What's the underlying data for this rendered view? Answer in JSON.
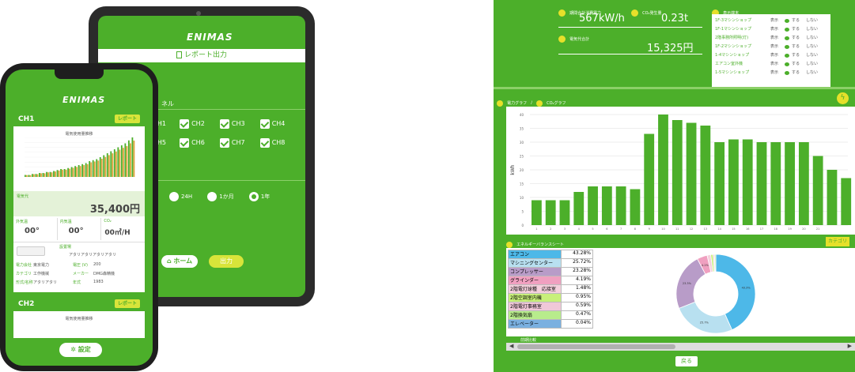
{
  "tablet": {
    "logo": "ENIMAS",
    "report_title": "レポート出力",
    "channel_section_suffix": "ネル",
    "channels": [
      "CH1",
      "CH2",
      "CH3",
      "CH4",
      "CH5",
      "CH6",
      "CH7",
      "CH8"
    ],
    "periods": [
      "24H",
      "1か月",
      "1年"
    ],
    "selected_period": "1年",
    "home_button": "ホーム",
    "output_button": "出力"
  },
  "phone": {
    "logo": "ENIMAS",
    "ch1": {
      "title": "CH1",
      "report_button": "レポート",
      "chart_title": "電気使用量推移",
      "chart_values": [
        2,
        2,
        3,
        3,
        4,
        4,
        5,
        5,
        6,
        7,
        8,
        8,
        9,
        10,
        11,
        12,
        13,
        14,
        16,
        17,
        18,
        20,
        22,
        24,
        26,
        28,
        30,
        32,
        34,
        37,
        40
      ],
      "electricity_cost_label": "電気代",
      "electricity_cost": "35,400円",
      "outdoor_temp_label": "外気温",
      "outdoor_temp": "00°",
      "indoor_temp_label": "内気温",
      "indoor_temp": "00°",
      "co2_label": "CO₂",
      "co2": "00㎥/H",
      "location_label": "設置場",
      "location": "アタリアタリアタリアタリ",
      "details": [
        {
          "label": "電力会社",
          "value": "東京電力",
          "label2": "電圧 (V)",
          "value2": "200"
        },
        {
          "label": "カテゴリ",
          "value": "工作機械",
          "label2": "メーカー",
          "value2": "DMG森精機"
        },
        {
          "label": "形式/名称",
          "value": "アタリアタリ",
          "label2": "年式",
          "value2": "1983"
        }
      ]
    },
    "ch2": {
      "title": "CH2",
      "report_button": "レポート",
      "chart_title": "電気使用量推移"
    },
    "settings_button": "設定"
  },
  "app": {
    "summary": {
      "period_power_label": "期間合計消費電力",
      "period_power": "567kW/h",
      "co2_label": "CO₂発生量",
      "co2": "0.23t",
      "cost_label": "電気代合計",
      "cost": "15,325円"
    },
    "display_terminal": {
      "title": "表示端末",
      "rows": [
        {
          "name": "1F-3マシンショップ",
          "show": "表示",
          "on": "する",
          "off": "しない"
        },
        {
          "name": "1F-1マシンショップ",
          "show": "表示",
          "on": "する",
          "off": "しない"
        },
        {
          "name": "2階事務所照明(灯)",
          "show": "表示",
          "on": "する",
          "off": "しない"
        },
        {
          "name": "1F-2マシンショップ",
          "show": "表示",
          "on": "する",
          "off": "しない"
        },
        {
          "name": "1-4マシンショップ",
          "show": "表示",
          "on": "する",
          "off": "しない"
        },
        {
          "name": "エアコン室外機",
          "show": "表示",
          "on": "する",
          "off": "しない"
        },
        {
          "name": "1-5マシンショップ",
          "show": "表示",
          "on": "する",
          "off": "しない"
        }
      ]
    },
    "graph_tabs": [
      "電力グラフ",
      "CO₂グラフ"
    ],
    "graph_tab_separator": "/",
    "energy_title": "エネルギーバランスシート",
    "category_button": "カテゴリ",
    "energy_rows": [
      {
        "name": "エアコン",
        "pct": "43.28%",
        "color": "#4db8e8"
      },
      {
        "name": "マシニングセンター",
        "pct": "25.72%",
        "color": "#b8e0f0"
      },
      {
        "name": "コンプレッサー",
        "pct": "23.28%",
        "color": "#b89cc8"
      },
      {
        "name": "グラインダー",
        "pct": "4.19%",
        "color": "#f0a0c0"
      },
      {
        "name": "2階電灯球種　応接室",
        "pct": "1.48%",
        "color": "#f4d0dc"
      },
      {
        "name": "2階空調室内機",
        "pct": "0.95%",
        "color": "#c8f07a"
      },
      {
        "name": "2階電灯事務室",
        "pct": "0.59%",
        "color": "#f0c8d8"
      },
      {
        "name": "2階換気扇",
        "pct": "0.47%",
        "color": "#b8ec8c"
      },
      {
        "name": "エレベーター",
        "pct": "0.04%",
        "color": "#7ab0e0"
      }
    ],
    "back_button": "戻る",
    "scroll_left": "◀",
    "scroll_right": "▶",
    "bottom_section_label": "前期比較"
  },
  "chart_data": {
    "type": "bar",
    "ylabel": "kWh",
    "ylim": [
      0,
      40
    ],
    "y_ticks": [
      0,
      5,
      10,
      15,
      20,
      25,
      30,
      35,
      40
    ],
    "categories": [
      "1",
      "2",
      "3",
      "4",
      "5",
      "6",
      "7",
      "8",
      "9",
      "10",
      "11",
      "12",
      "13",
      "14",
      "15",
      "16",
      "17",
      "18",
      "19",
      "20",
      "21"
    ],
    "values": [
      9,
      9,
      9,
      12,
      14,
      14,
      14,
      13,
      33,
      40,
      38,
      37,
      36,
      30,
      31,
      31,
      30,
      30,
      30,
      30,
      25,
      20,
      17
    ],
    "series_color": "#4caf2a",
    "grid": true
  }
}
